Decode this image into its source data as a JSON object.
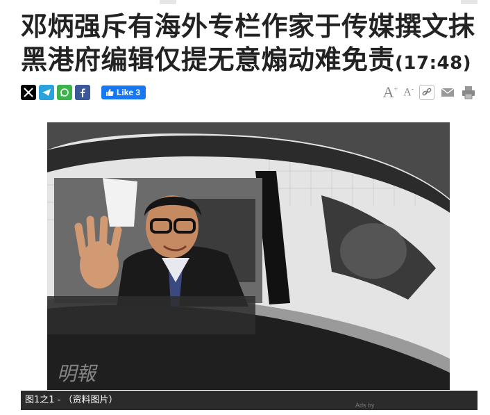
{
  "article": {
    "title": "邓炳强斥有海外专栏作家于传媒撰文抹黑港府编辑仅提无意煽动难免责",
    "time": "(17:48)"
  },
  "share": {
    "icons": [
      "x-icon",
      "telegram-icon",
      "whatsapp-icon",
      "facebook-icon"
    ],
    "like_label": "Like 3"
  },
  "tools": {
    "font_increase": "A",
    "font_increase_sign": "+",
    "font_decrease": "A",
    "font_decrease_sign": "-",
    "icons": [
      "link-icon",
      "email-icon",
      "print-icon"
    ]
  },
  "photo": {
    "caption": "图1之1 - （资料图片）",
    "watermark": "明報"
  },
  "ads": {
    "label": "Ads by"
  },
  "colors": {
    "facebook": "#1877f2",
    "caption_bg": "#2b2b2b"
  }
}
